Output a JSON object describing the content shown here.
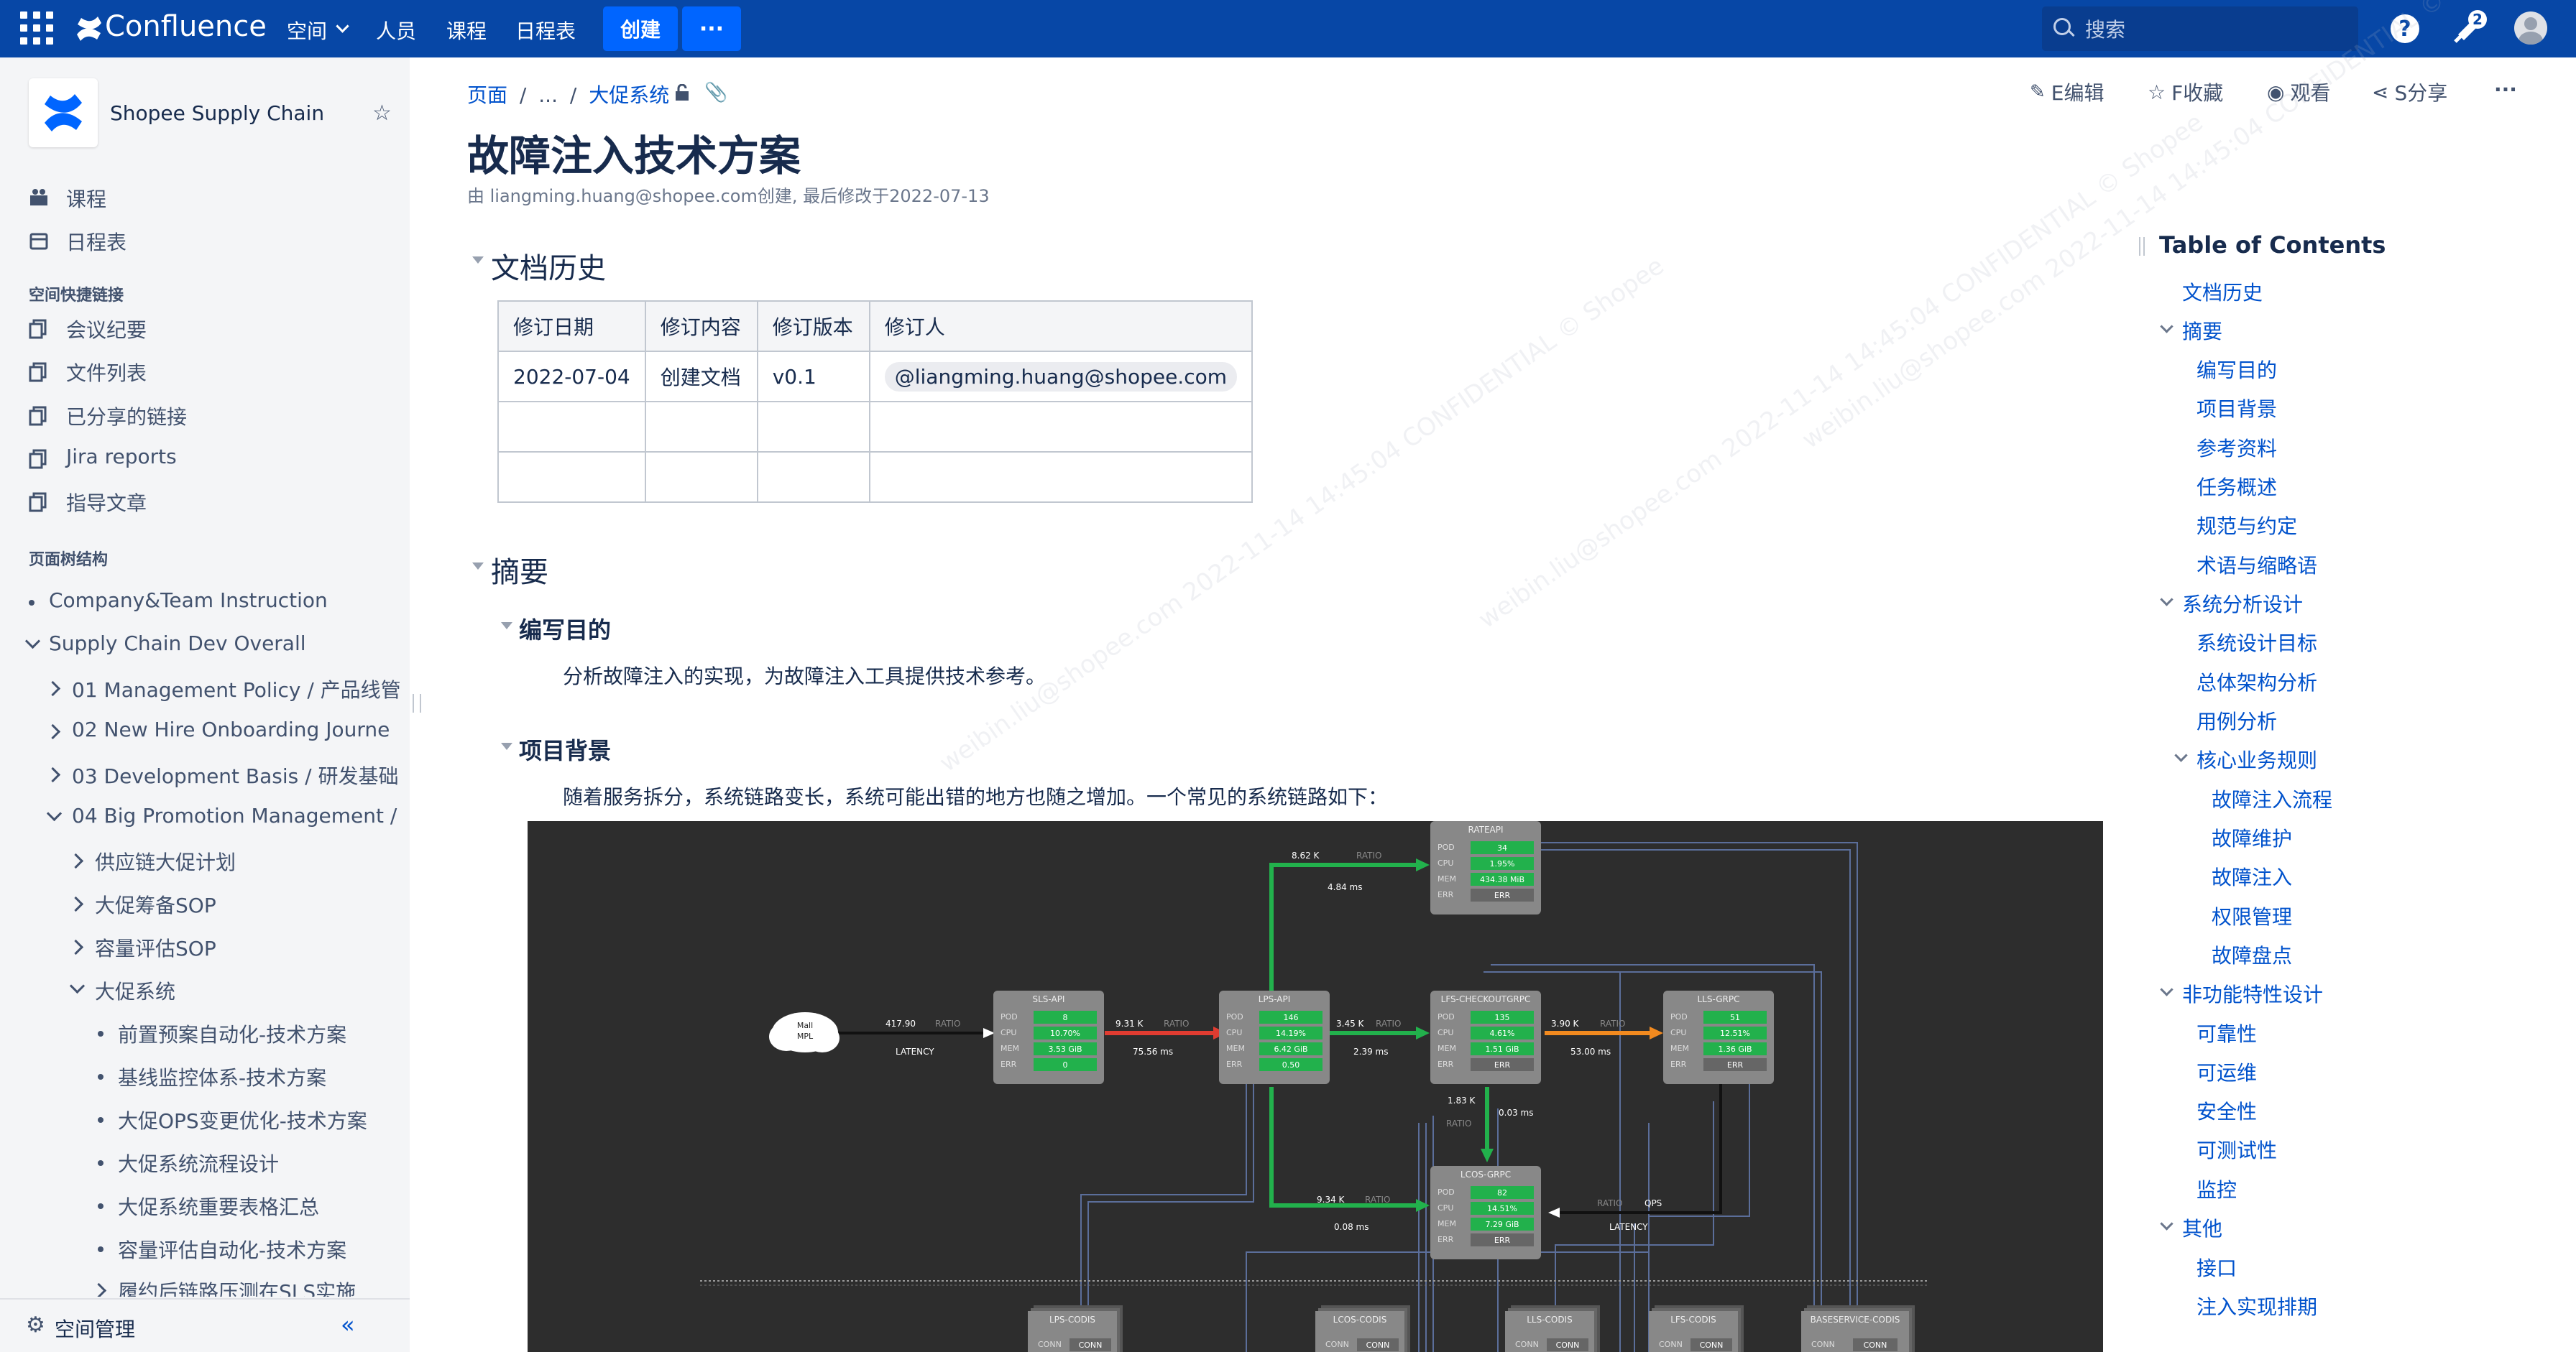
{
  "topnav": {
    "brand": "Confluence",
    "menu": [
      "空间",
      "人员",
      "课程",
      "日程表"
    ],
    "create_label": "创建",
    "more_label": "···",
    "search_placeholder": "搜索",
    "notification_count": "2"
  },
  "sidebar": {
    "space_name": "Shopee Supply Chain",
    "top_items": [
      "课程",
      "日程表"
    ],
    "shortcuts_header": "空间快捷链接",
    "shortcuts": [
      "会议纪要",
      "文件列表",
      "已分享的链接",
      "Jira reports",
      "指导文章"
    ],
    "tree_header": "页面树结构",
    "tree": [
      "Company&Team Instruction",
      "Supply Chain Dev Overall",
      "01 Management Policy / 产品线管",
      "02 New Hire Onboarding Journe",
      "03 Development Basis / 研发基础",
      "04 Big Promotion Management /",
      "供应链大促计划",
      "大促筹备SOP",
      "容量评估SOP",
      "大促系统",
      "前置预案自动化-技术方案",
      "基线监控体系-技术方案",
      "大促OPS变更优化-技术方案",
      "大促系统流程设计",
      "大促系统重要表格汇总",
      "容量评估自动化-技术方案",
      "履约后链路压测在SLS实施"
    ],
    "footer_label": "空间管理"
  },
  "breadcrumb": {
    "root": "页面",
    "ellipsis": "...",
    "parent": "大促系统"
  },
  "toolbar": {
    "edit": "E编辑",
    "favorite": "F收藏",
    "watch": "观看",
    "share": "S分享",
    "more": "···"
  },
  "page": {
    "title": "故障注入技术方案",
    "byline": "由 liangming.huang@shopee.com创建, 最后修改于2022-07-13",
    "sections": {
      "history": "文档历史",
      "summary": "摘要",
      "purpose": "编写目的",
      "purpose_text": "分析故障注入的实现，为故障注入工具提供技术参考。",
      "background": "项目背景",
      "background_text": "随着服务拆分，系统链路变长，系统可能出错的地方也随之增加。一个常见的系统链路如下："
    },
    "history_table": {
      "headers": [
        "修订日期",
        "修订内容",
        "修订版本",
        "修订人"
      ],
      "rows": [
        [
          "2022-07-04",
          "创建文档",
          "v0.1",
          "@liangming.huang@shopee.com"
        ],
        [
          "",
          "",
          "",
          ""
        ],
        [
          "",
          "",
          "",
          ""
        ]
      ]
    }
  },
  "toc": {
    "title": "Table of Contents",
    "items": [
      "文档历史",
      "摘要",
      "编写目的",
      "项目背景",
      "参考资料",
      "任务概述",
      "规范与约定",
      "术语与缩略语",
      "系统分析设计",
      "系统设计目标",
      "总体架构分析",
      "用例分析",
      "核心业务规则",
      "故障注入流程",
      "故障维护",
      "故障注入",
      "权限管理",
      "故障盘点",
      "非功能特性设计",
      "可靠性",
      "可运维",
      "安全性",
      "可测试性",
      "监控",
      "其他",
      "接口",
      "注入实现排期"
    ]
  },
  "diagram": {
    "cloud_label": [
      "Mall",
      "MPL"
    ],
    "row_labels": [
      "POD",
      "CPU",
      "MEM",
      "ERR"
    ],
    "nodes": {
      "rateapi": {
        "title": "RATEAPI",
        "values": [
          "34",
          "1.95%",
          "434.38 MiB",
          "ERR"
        ]
      },
      "slsapi": {
        "title": "SLS-API",
        "values": [
          "8",
          "10.70%",
          "3.53 GiB",
          "0"
        ]
      },
      "lpsapi": {
        "title": "LPS-API",
        "values": [
          "146",
          "14.19%",
          "6.42 GiB",
          "0.50"
        ]
      },
      "lfscheckout": {
        "title": "LFS-CHECKOUTGRPC",
        "values": [
          "135",
          "4.61%",
          "1.51 GiB",
          "ERR"
        ]
      },
      "llsgrpc": {
        "title": "LLS-GRPC",
        "values": [
          "51",
          "12.51%",
          "1.36 GiB",
          "ERR"
        ]
      },
      "lcosgrpc": {
        "title": "LCOS-GRPC",
        "values": [
          "82",
          "14.51%",
          "7.29 GiB",
          "ERR"
        ]
      }
    },
    "edges": {
      "e1": {
        "rate": "417.90",
        "ratio": "RATIO",
        "latency": "LATENCY"
      },
      "e2": {
        "rate": "9.31 K",
        "ratio": "RATIO",
        "latency": "75.56 ms"
      },
      "e3": {
        "rate": "8.62 K",
        "ratio": "RATIO",
        "latency": "4.84 ms"
      },
      "e4": {
        "rate": "3.45 K",
        "ratio": "RATIO",
        "latency": "2.39 ms"
      },
      "e5": {
        "rate": "3.90 K",
        "ratio": "RATIO",
        "latency": "53.00 ms"
      },
      "e6": {
        "rate": "1.83 K",
        "ratio": "RATIO",
        "latency": "0.03 ms"
      },
      "e7": {
        "rate": "9.34 K",
        "ratio": "RATIO",
        "latency": "0.08 ms"
      },
      "e8": {
        "ratio": "RATIO",
        "qps": "QPS",
        "latency": "LATENCY"
      }
    },
    "bottom_nodes": [
      "LPS-CODIS",
      "LCOS-CODIS",
      "LLS-CODIS",
      "LFS-CODIS",
      "BASESERVICE-CODIS"
    ],
    "conn_label": "CONN"
  },
  "watermark": "weibin.liu@shopee.com 2022-11-14 14:45:04 CONFIDENTIAL © Shopee",
  "colors": {
    "nav": "#0747a6",
    "create": "#0065ff",
    "link": "#0052cc",
    "sidebar": "#f4f5f7",
    "green": "#22b14c",
    "red": "#e03c31",
    "orange": "#f28a1f"
  }
}
